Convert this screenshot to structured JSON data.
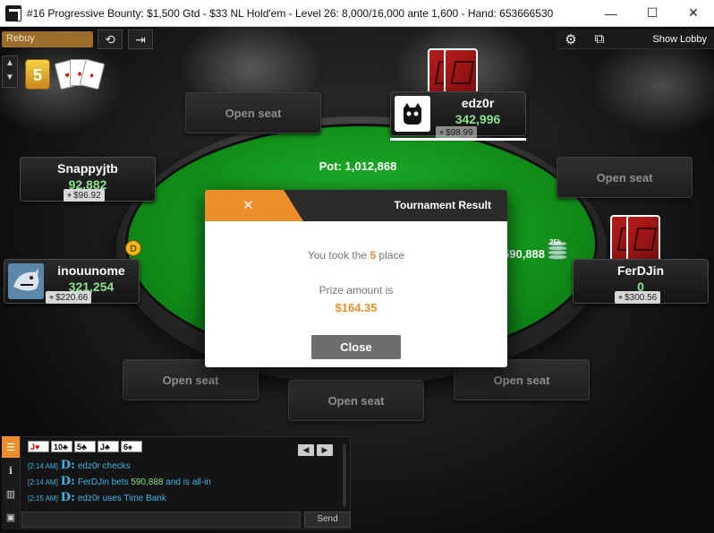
{
  "window": {
    "title": "#16 Progressive Bounty: $1,500 Gtd - $33 NL Hold'em - Level 26: 8,000/16,000 ante 1,600 - Hand: 653666530",
    "minimize": "—",
    "maximize": "☐",
    "close": "✕"
  },
  "toolbar": {
    "rebuy_label": "Rebuy",
    "show_lobby_label": "Show Lobby"
  },
  "bonus": {
    "badge": "5"
  },
  "table": {
    "pot_label": "Pot: 1,012,868",
    "dealer_label": "D",
    "ferdjin_bet": "590,888",
    "chip_label": "25k"
  },
  "seats": {
    "open_seat_label": "Open seat"
  },
  "players": {
    "edz0r": {
      "name": "edz0r",
      "stack": "342,996",
      "bounty": "$98.99"
    },
    "snappyjtb": {
      "name": "Snappyjtb",
      "stack": "92,882",
      "bounty": "$96.92"
    },
    "inouunome": {
      "name": "inouunome",
      "stack": "321,254",
      "bounty": "$220.66"
    },
    "ferdjin": {
      "name": "FerDJin",
      "stack": "0",
      "bounty": "$300.56"
    }
  },
  "modal": {
    "close_icon": "✕",
    "title": "Tournament Result",
    "took_prefix": "You took the",
    "place": "5",
    "took_suffix": "place",
    "prize_label": "Prize amount is",
    "prize_amount": "$164.35",
    "close_button": "Close"
  },
  "chat": {
    "board": [
      {
        "rank": "J",
        "suit": "♥",
        "red": true
      },
      {
        "rank": "10",
        "suit": "♣",
        "red": false
      },
      {
        "rank": "5",
        "suit": "♣",
        "red": false
      },
      {
        "rank": "J",
        "suit": "♣",
        "red": false
      },
      {
        "rank": "6",
        "suit": "♠",
        "red": false
      }
    ],
    "nav_prev": "◀",
    "nav_next": "▶",
    "messages": [
      {
        "time": "[2:14 AM]",
        "d": "D:",
        "text": "edz0r  checks",
        "amount": "",
        "suffix": ""
      },
      {
        "time": "[2:14 AM]",
        "d": "D:",
        "text": "FerDJin  bets ",
        "amount": "590,888",
        "suffix": " and is all-in"
      },
      {
        "time": "[2:15 AM]",
        "d": "D:",
        "text": "edz0r  uses Time Bank",
        "amount": "",
        "suffix": ""
      }
    ],
    "send_label": "Send"
  },
  "colors": {
    "accent": "#ec8e2c",
    "felt": "#1aa324",
    "chat_text": "#3db4e6",
    "stack_text": "#8be28b"
  },
  "icons": [
    "refresh-icon",
    "exit-icon",
    "gear-icon",
    "window-layout-icon",
    "chat-icon",
    "info-icon",
    "stats-icon",
    "notes-icon"
  ]
}
